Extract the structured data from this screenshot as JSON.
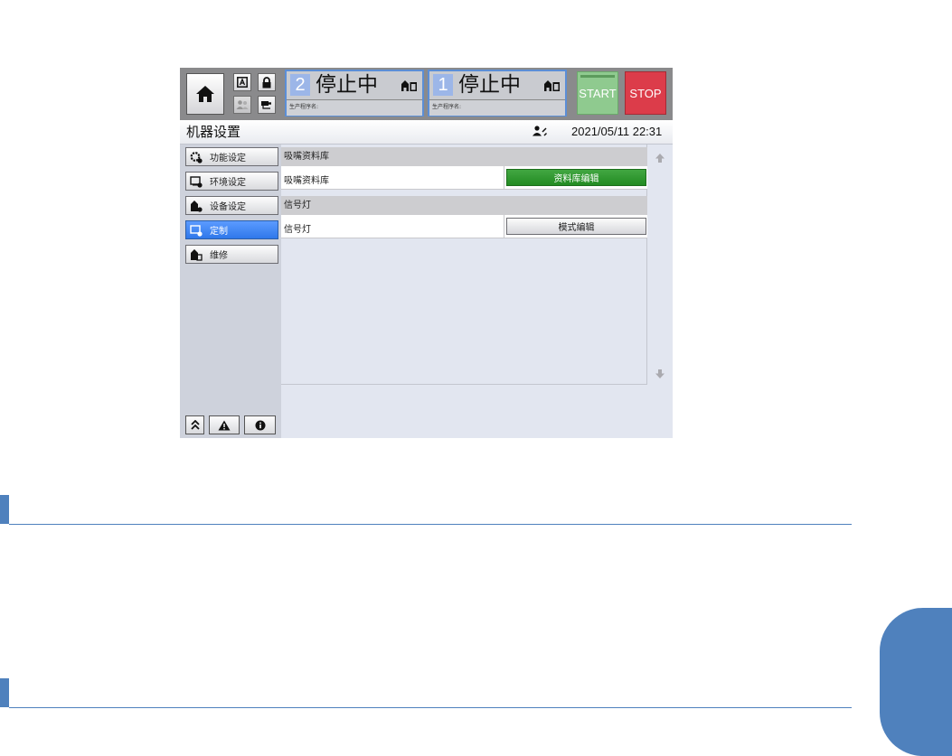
{
  "header": {
    "machine_panels": [
      {
        "number": "2",
        "status": "停止中",
        "program_label": "生产程序名:"
      },
      {
        "number": "1",
        "status": "停止中",
        "program_label": "生产程序名:"
      }
    ],
    "start_label": "START",
    "stop_label": "STOP",
    "icons": [
      "home-icon",
      "a-box-icon",
      "lock-icon",
      "users-icon",
      "usb-icon"
    ]
  },
  "titlebar": {
    "title": "机器设置",
    "datetime": "2021/05/11 22:31"
  },
  "sidebar": {
    "items": [
      {
        "label": "功能设定",
        "icon": "function-icon",
        "active": false
      },
      {
        "label": "环境设定",
        "icon": "environment-icon",
        "active": false
      },
      {
        "label": "设备设定",
        "icon": "device-icon",
        "active": false
      },
      {
        "label": "定制",
        "icon": "custom-icon",
        "active": true
      },
      {
        "label": "维修",
        "icon": "maintenance-icon",
        "active": false
      }
    ],
    "bottom_icons": [
      "double-chevron-up-icon",
      "warning-icon",
      "info-icon"
    ]
  },
  "content": {
    "sections": [
      {
        "header": "吸嘴资料库",
        "row_label": "吸嘴资料库",
        "button_label": "资料库编辑",
        "button_style": "green"
      },
      {
        "header": "信号灯",
        "row_label": "信号灯",
        "button_label": "模式编辑",
        "button_style": "gray"
      }
    ]
  },
  "colors": {
    "accent_blue": "#4f81bd",
    "active_item": "#2f78ea",
    "start_green": "#8fca8f",
    "stop_red": "#dc3c4a",
    "edit_green": "#228b22"
  }
}
